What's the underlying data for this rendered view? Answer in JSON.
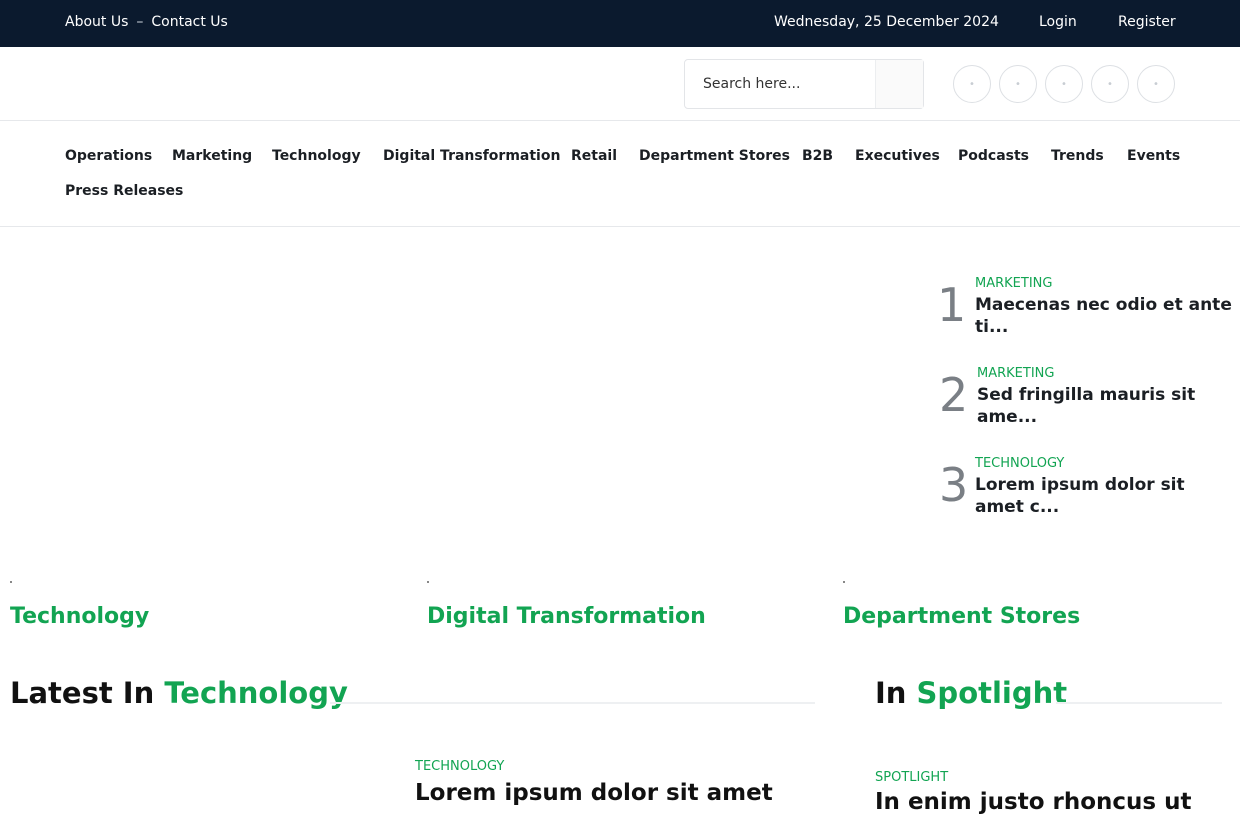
{
  "topbar": {
    "about": "About Us",
    "separator": "–",
    "contact": "Contact Us",
    "date": "Wednesday, 25 December 2024",
    "login": "Login",
    "register": "Register"
  },
  "search": {
    "placeholder": "Search here..."
  },
  "social": [
    "facebook-icon",
    "twitter-icon",
    "instagram-icon",
    "linkedin-icon",
    "youtube-icon"
  ],
  "nav": {
    "items": [
      "Operations",
      "Marketing",
      "Technology",
      "Digital Transformation",
      "Retail",
      "Department Stores",
      "B2B",
      "Executives",
      "Podcasts",
      "Trends",
      "Events",
      "Press Releases"
    ]
  },
  "trending": [
    {
      "num": "1",
      "category": "MARKETING",
      "title": "Maecenas nec odio et ante ti..."
    },
    {
      "num": "2",
      "category": "MARKETING",
      "title": "Sed fringilla mauris sit ame..."
    },
    {
      "num": "3",
      "category": "TECHNOLOGY",
      "title": "Lorem ipsum dolor sit amet c..."
    }
  ],
  "categories": [
    "Technology",
    "Digital Transformation",
    "Department Stores"
  ],
  "latest": {
    "prefix": "Latest In ",
    "accent": "Technology",
    "category": "TECHNOLOGY",
    "title": "Lorem ipsum dolor sit amet"
  },
  "spotlight": {
    "prefix": "In ",
    "accent": "Spotlight",
    "category": "SPOTLIGHT",
    "title": "In enim justo rhoncus ut"
  },
  "colors": {
    "accent": "#12a452",
    "topbar": "#0b1a2e"
  }
}
